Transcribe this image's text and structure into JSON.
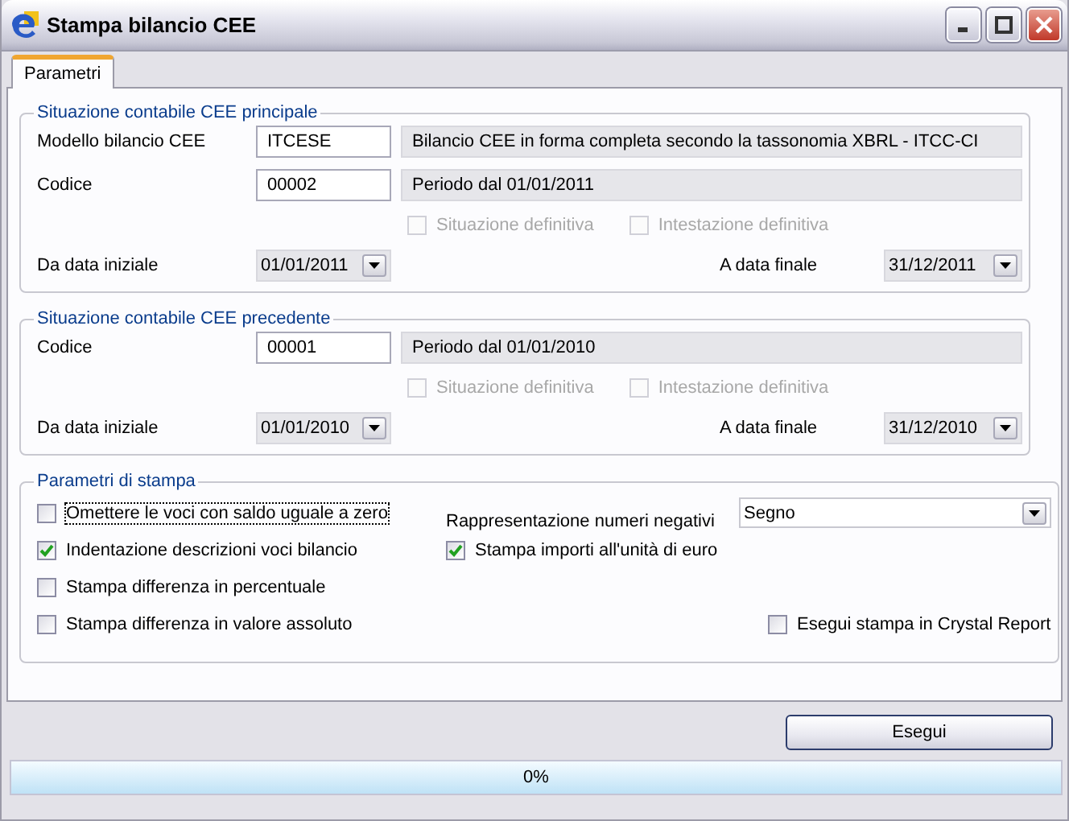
{
  "window": {
    "title": "Stampa bilancio CEE"
  },
  "tabs": [
    {
      "label": "Parametri",
      "selected": true
    }
  ],
  "sections": [
    {
      "title": "Situazione contabile CEE principale",
      "fields": [
        {
          "label": "Modello bilancio CEE",
          "value": "ITCESE",
          "description": "Bilancio CEE in forma completa secondo la tassonomia XBRL - ITCC-CI"
        },
        {
          "label": "Codice",
          "value": "00002",
          "description": "Periodo dal 01/01/2011"
        }
      ],
      "checkboxes": [
        {
          "label": "Situazione definitiva",
          "checked": false,
          "disabled": true
        },
        {
          "label": "Intestazione definitiva",
          "checked": false,
          "disabled": true
        }
      ],
      "date_from": {
        "label": "Da data iniziale",
        "value": "01/01/2011"
      },
      "date_to": {
        "label": "A data finale",
        "value": "31/12/2011"
      }
    },
    {
      "title": "Situazione contabile CEE precedente",
      "fields": [
        {
          "label": "Codice",
          "value": "00001",
          "description": "Periodo dal 01/01/2010"
        }
      ],
      "checkboxes": [
        {
          "label": "Situazione definitiva",
          "checked": false,
          "disabled": true
        },
        {
          "label": "Intestazione definitiva",
          "checked": false,
          "disabled": true
        }
      ],
      "date_from": {
        "label": "Da data iniziale",
        "value": "01/01/2010"
      },
      "date_to": {
        "label": "A data finale",
        "value": "31/12/2010"
      }
    }
  ],
  "print_params": {
    "title": "Parametri di stampa",
    "options_left": [
      {
        "label": "Omettere le voci con saldo uguale a zero",
        "checked": false,
        "focused": true
      },
      {
        "label": "Indentazione descrizioni voci bilancio",
        "checked": true,
        "focused": false
      },
      {
        "label": "Stampa differenza in percentuale",
        "checked": false,
        "focused": false
      },
      {
        "label": "Stampa differenza in valore assoluto",
        "checked": false,
        "focused": false
      }
    ],
    "negative_label": "Rappresentazione numeri negativi",
    "negative_select": "Segno",
    "option_middle": {
      "label": "Stampa importi all'unità di euro",
      "checked": true,
      "focused": false
    },
    "option_right": {
      "label": "Esegui stampa in Crystal Report",
      "checked": false,
      "focused": false
    }
  },
  "run_button": "Esegui",
  "progress": {
    "label": "0%",
    "level": 0
  }
}
